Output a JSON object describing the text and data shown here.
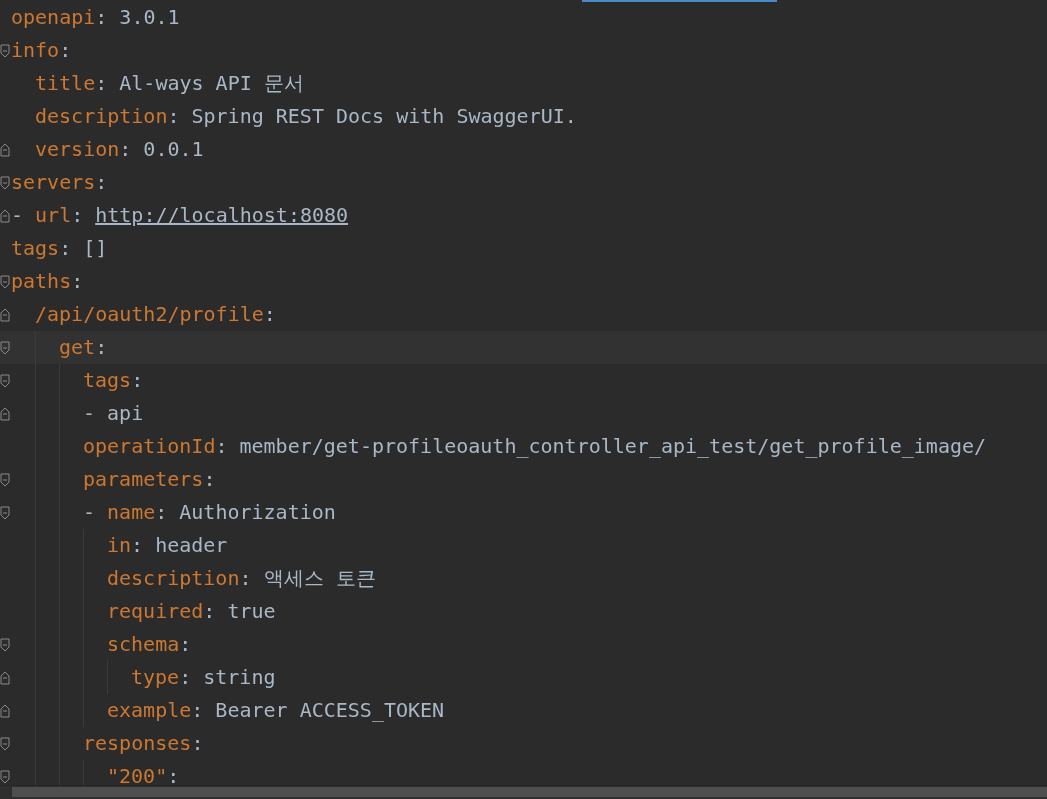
{
  "editor": {
    "lines": [
      {
        "key": "openapi",
        "sep": ":",
        "value": "3.0.1"
      },
      {
        "key": "info",
        "sep": ":",
        "fold_start": true,
        "children": [
          {
            "key": "title",
            "sep": ":",
            "value": "Al-ways API 문서"
          },
          {
            "key": "description",
            "sep": ":",
            "value": "Spring REST Docs with SwaggerUI."
          },
          {
            "key": "version",
            "sep": ":",
            "value": "0.0.1",
            "fold_end": true
          }
        ]
      },
      {
        "key": "servers",
        "sep": ":",
        "fold_start": true,
        "children": [
          {
            "dash": "-",
            "key": "url",
            "sep": ":",
            "value": "http://localhost:8080",
            "kind": "link",
            "fold_end": true
          }
        ]
      },
      {
        "key": "tags",
        "sep": ":",
        "value": "[]"
      },
      {
        "key": "paths",
        "sep": ":",
        "fold_start": true,
        "children": [
          {
            "key": "/api/oauth2/profile",
            "sep": ":",
            "fold_end": true,
            "children": [
              {
                "key": "get",
                "sep": ":",
                "fold_start": true,
                "current": true,
                "children": [
                  {
                    "key": "tags",
                    "sep": ":",
                    "fold_start": true,
                    "children": [
                      {
                        "dash": "-",
                        "value": "api",
                        "fold_end": true
                      }
                    ]
                  },
                  {
                    "key": "operationId",
                    "sep": ":",
                    "value": "member/get-profileoauth_controller_api_test/get_profile_image/"
                  },
                  {
                    "key": "parameters",
                    "sep": ":",
                    "fold_start": true,
                    "children": [
                      {
                        "dash": "-",
                        "key": "name",
                        "sep": ":",
                        "value": "Authorization",
                        "fold_start": true,
                        "children": [
                          {
                            "key": "in",
                            "sep": ":",
                            "value": "header"
                          },
                          {
                            "key": "description",
                            "sep": ":",
                            "value": "액세스 토큰"
                          },
                          {
                            "key": "required",
                            "sep": ":",
                            "value": "true"
                          },
                          {
                            "key": "schema",
                            "sep": ":",
                            "fold_start": true,
                            "children": [
                              {
                                "key": "type",
                                "sep": ":",
                                "value": "string",
                                "fold_end": true
                              }
                            ]
                          },
                          {
                            "key": "example",
                            "sep": ":",
                            "value": "Bearer ACCESS_TOKEN",
                            "fold_end": true
                          }
                        ]
                      }
                    ]
                  },
                  {
                    "key": "responses",
                    "sep": ":",
                    "fold_start": true,
                    "children": [
                      {
                        "key": "\"200\"",
                        "sep": ":",
                        "fold_start": true
                      }
                    ]
                  }
                ]
              }
            ]
          }
        ]
      }
    ]
  }
}
